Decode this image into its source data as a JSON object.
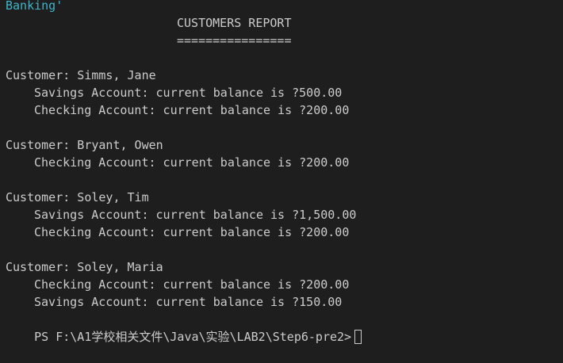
{
  "header_fragment": "Banking'",
  "report": {
    "title": "CUSTOMERS REPORT",
    "underline": "================"
  },
  "customers": [
    {
      "label": "Customer: Simms, Jane",
      "accounts": [
        "Savings Account: current balance is ?500.00",
        "Checking Account: current balance is ?200.00"
      ]
    },
    {
      "label": "Customer: Bryant, Owen",
      "accounts": [
        "Checking Account: current balance is ?200.00"
      ]
    },
    {
      "label": "Customer: Soley, Tim",
      "accounts": [
        "Savings Account: current balance is ?1,500.00",
        "Checking Account: current balance is ?200.00"
      ]
    },
    {
      "label": "Customer: Soley, Maria",
      "accounts": [
        "Checking Account: current balance is ?200.00",
        "Savings Account: current balance is ?150.00"
      ]
    }
  ],
  "prompt": "PS F:\\A1学校相关文件\\Java\\实验\\LAB2\\Step6-pre2>",
  "colors": {
    "background": "#1e1e1e",
    "text": "#cccccc",
    "header_accent": "#3fb6c8"
  }
}
